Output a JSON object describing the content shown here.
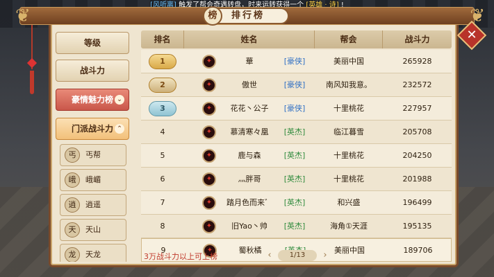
{
  "broadcast": {
    "user": "[风听离]",
    "message": "触发了帮会奇遇转盘，时来运转获得一个",
    "item": "[英雄 · 诗]",
    "suffix": "!"
  },
  "title": "排行榜",
  "title_emblem": "榜",
  "close_label": "✕",
  "side_hud": "之\n同\n刚\n",
  "sidebar": {
    "tabs": [
      {
        "label": "等级"
      },
      {
        "label": "战斗力"
      },
      {
        "label": "豪情魅力榜"
      },
      {
        "label": "门派战斗力"
      }
    ],
    "subtabs": [
      {
        "label": "丐帮",
        "icon": "丐"
      },
      {
        "label": "峨嵋",
        "icon": "峨"
      },
      {
        "label": "逍遥",
        "icon": "逍"
      },
      {
        "label": "天山",
        "icon": "天"
      },
      {
        "label": "天龙",
        "icon": "龙"
      }
    ]
  },
  "table": {
    "headers": {
      "rank": "排名",
      "name": "姓名",
      "guild": "帮会",
      "power": "战斗力"
    },
    "rows": [
      {
        "rank": "1",
        "name": "華",
        "title": "[豪侠]",
        "guild": "美丽中国",
        "power": "265928"
      },
      {
        "rank": "2",
        "name": "傲世",
        "title": "[豪侠]",
        "guild": "南风知我意。",
        "power": "232572"
      },
      {
        "rank": "3",
        "name": "花花丶公子",
        "title": "[豪侠]",
        "guild": "十里桃花",
        "power": "227957"
      },
      {
        "rank": "4",
        "name": "慕清寒々凰",
        "title": "[英杰]",
        "guild": "临江暮雪",
        "power": "205708"
      },
      {
        "rank": "5",
        "name": "鹿与森",
        "title": "[英杰]",
        "guild": "十里桃花",
        "power": "204250"
      },
      {
        "rank": "6",
        "name": "灬胖哥",
        "title": "[英杰]",
        "guild": "十里桃花",
        "power": "201988"
      },
      {
        "rank": "7",
        "name": "踏月色而来゛",
        "title": "[英杰]",
        "guild": "和兴盛",
        "power": "196499"
      },
      {
        "rank": "8",
        "name": "旧Yao丶帅",
        "title": "[英杰]",
        "guild": "海角①天涯",
        "power": "195135"
      },
      {
        "rank": "9",
        "name": "蜀秋橘",
        "title": "[英杰]",
        "guild": "美丽中国",
        "power": "189706"
      }
    ]
  },
  "footer": {
    "note": "3万战斗力以上可上榜",
    "page": "1/13",
    "prev": "‹",
    "next": "›"
  },
  "colors": {
    "accent_red": "#c0392b",
    "hero_blue": "#2f6fc4",
    "elite_green": "#2f8a3c"
  }
}
